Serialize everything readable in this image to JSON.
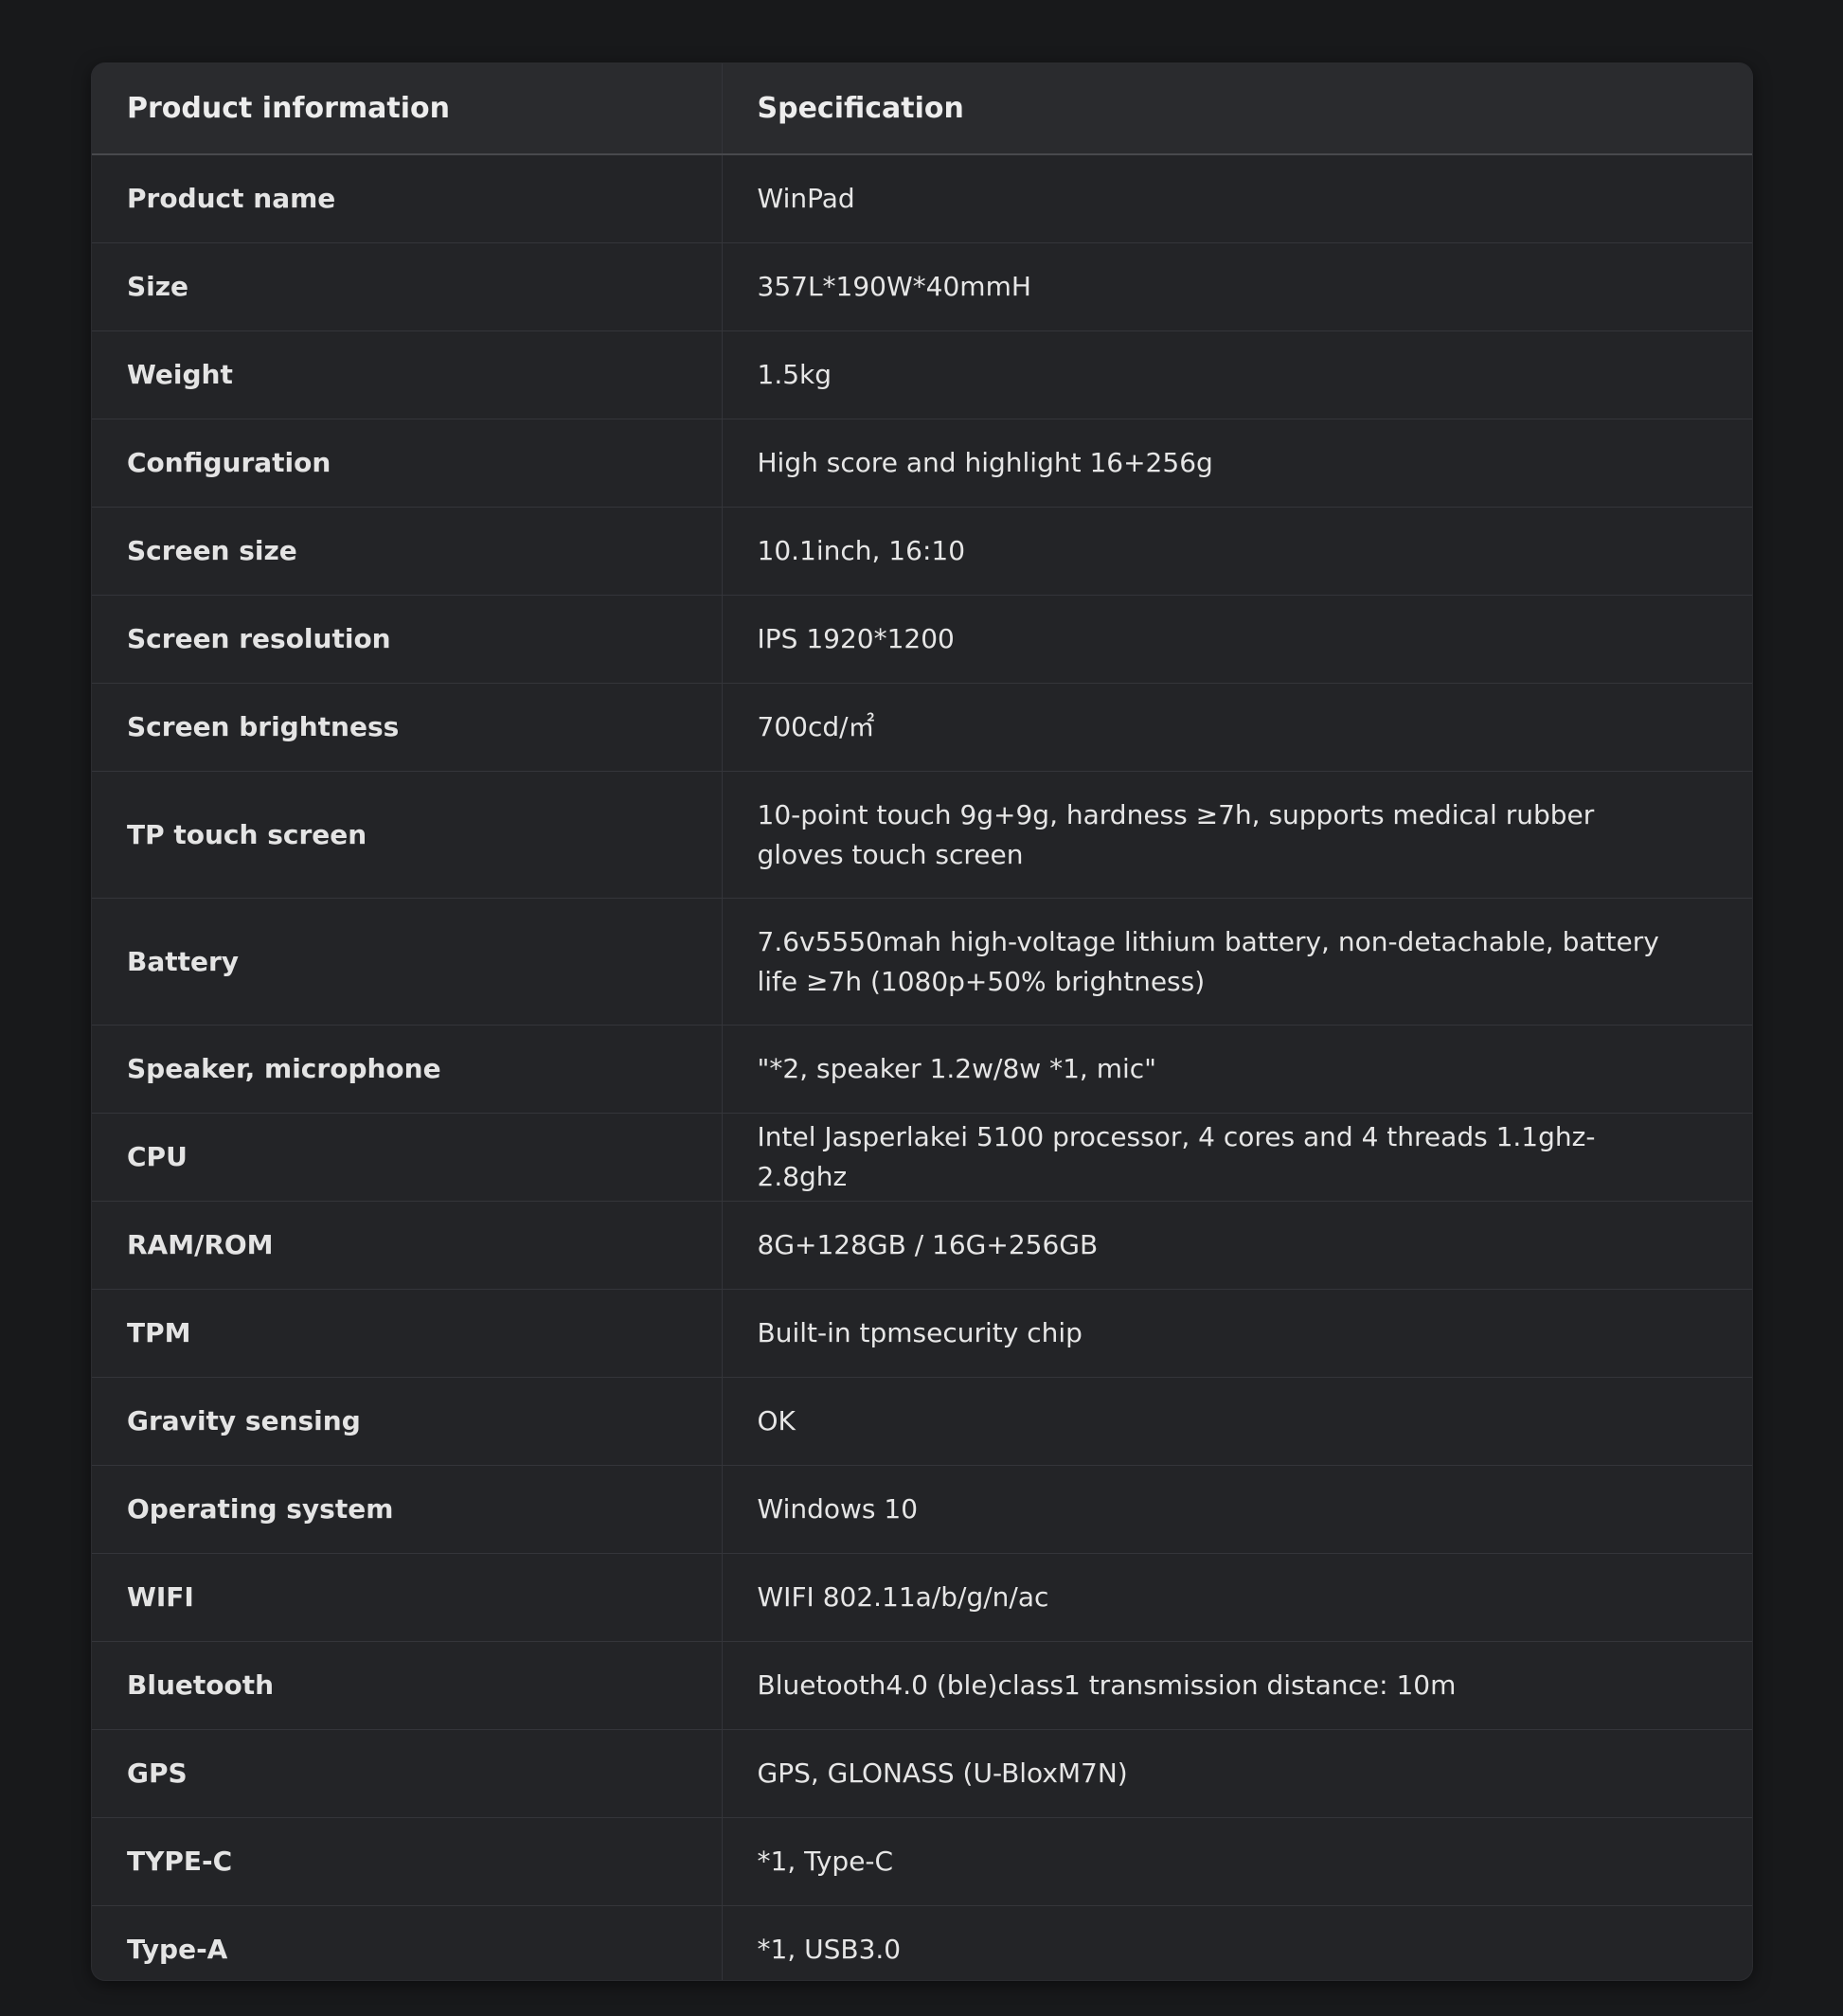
{
  "table": {
    "headers": [
      "Product information",
      "Specification"
    ],
    "rows": [
      {
        "key": "Product name",
        "value": "WinPad"
      },
      {
        "key": "Size",
        "value": "357L*190W*40mmH"
      },
      {
        "key": "Weight",
        "value": "1.5kg"
      },
      {
        "key": "Configuration",
        "value": "High score and highlight 16+256g"
      },
      {
        "key": "Screen size",
        "value": "10.1inch, 16:10"
      },
      {
        "key": "Screen resolution",
        "value": "IPS 1920*1200"
      },
      {
        "key": "Screen brightness",
        "value": "700cd/㎡"
      },
      {
        "key": "TP touch screen",
        "value": "10-point touch 9g+9g, hardness ≥7h, supports medical rubber gloves touch screen"
      },
      {
        "key": "Battery",
        "value": "7.6v5550mah high-voltage lithium battery, non-detachable, battery life ≥7h (1080p+50% brightness)"
      },
      {
        "key": "Speaker, microphone",
        "value": "\"*2, speaker 1.2w/8w *1, mic\""
      },
      {
        "key": "CPU",
        "value": "Intel Jasperlakei 5100 processor, 4 cores and 4 threads 1.1ghz-2.8ghz"
      },
      {
        "key": "RAM/ROM",
        "value": "8G+128GB / 16G+256GB"
      },
      {
        "key": "TPM",
        "value": "Built-in tpmsecurity chip"
      },
      {
        "key": "Gravity sensing",
        "value": "OK"
      },
      {
        "key": "Operating system",
        "value": "Windows 10"
      },
      {
        "key": "WIFI",
        "value": "WIFI 802.11a/b/g/n/ac"
      },
      {
        "key": "Bluetooth",
        "value": "Bluetooth4.0 (ble)class1 transmission distance: 10m"
      },
      {
        "key": "GPS",
        "value": "GPS, GLONASS (U-BloxM7N)"
      },
      {
        "key": "TYPE-C",
        "value": "*1, Type-C"
      },
      {
        "key": "Type-A",
        "value": "*1, USB3.0"
      }
    ]
  }
}
